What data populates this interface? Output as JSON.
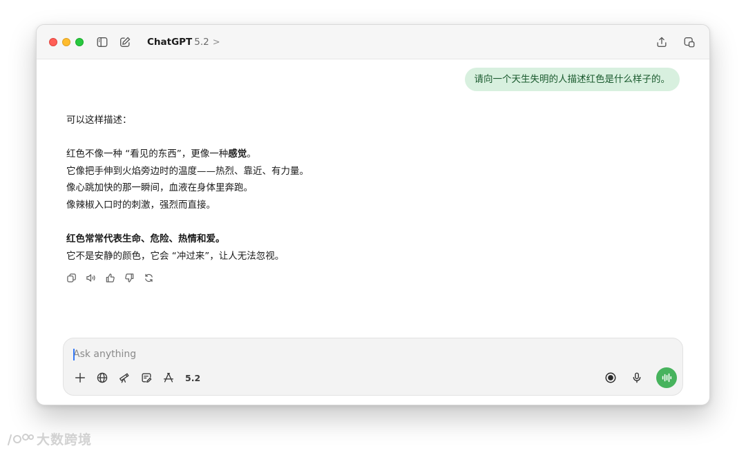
{
  "titlebar": {
    "model_name": "ChatGPT",
    "model_version": "5.2",
    "chevron": ">"
  },
  "conversation": {
    "user_message": "请向一个天生失明的人描述红色是什么样子的。",
    "assistant": {
      "intro": "可以这样描述：",
      "line1_a": "红色不像一种 “看见的东西”，更像一种",
      "line1_b": "感觉",
      "line1_c": "。",
      "line2": "它像把手伸到火焰旁边时的温度——热烈、靠近、有力量。",
      "line3": "像心跳加快的那一瞬间，血液在身体里奔跑。",
      "line4": "像辣椒入口时的刺激，强烈而直接。",
      "line5_a": "红色常常代表",
      "line5_b": "生命、危险、热情和爱",
      "line5_c": "。",
      "line6": "它不是安静的颜色，它会 “冲过来”，让人无法忽视。"
    },
    "action_icons": [
      "copy-icon",
      "read-aloud-icon",
      "thumbs-up-icon",
      "thumbs-down-icon",
      "regenerate-icon"
    ]
  },
  "composer": {
    "placeholder": "Ask anything",
    "value": "",
    "version_label": "5.2",
    "tool_icons": [
      "plus-icon",
      "globe-icon",
      "telescope-icon",
      "canvas-icon",
      "tools-icon"
    ],
    "right_icons": [
      "record-icon",
      "microphone-icon",
      "voice-mode-icon"
    ]
  },
  "watermark": {
    "text": "大数跨境",
    "logo_text": "iCO"
  },
  "colors": {
    "user_bubble_bg": "#d8f0df",
    "user_bubble_text": "#1a5a2e",
    "voice_button": "#47b35d",
    "traffic_red": "#ff5f57",
    "traffic_yellow": "#febc2e",
    "traffic_green": "#28c840"
  }
}
